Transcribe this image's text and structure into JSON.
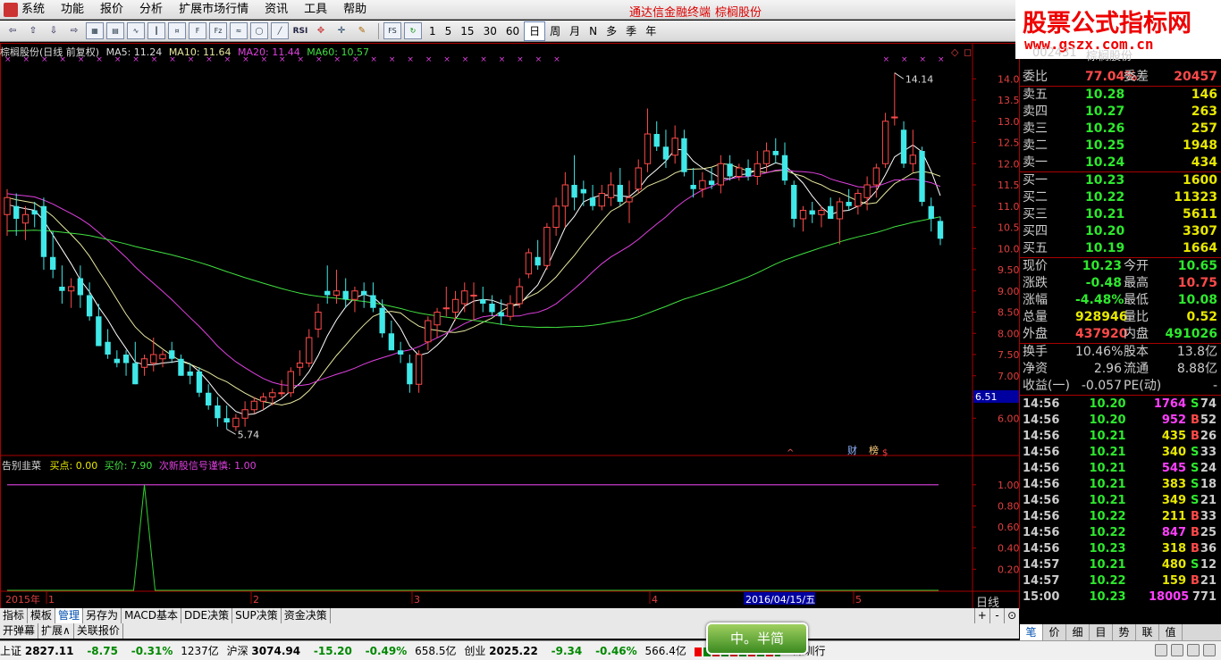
{
  "menu": {
    "items": [
      "系统",
      "功能",
      "报价",
      "分析",
      "扩展市场行情",
      "资讯",
      "工具",
      "帮助"
    ],
    "terminal_title": "通达信金融终端",
    "stock_name": "棕榈股份"
  },
  "watermark": {
    "title": "股票公式指标网",
    "url": "www.gszx.com.cn"
  },
  "toolbar": {
    "periods": [
      "1",
      "5",
      "15",
      "30",
      "60"
    ],
    "tf": [
      "日",
      "周",
      "月",
      "N",
      "多",
      "季",
      "年"
    ],
    "active_tf": "日",
    "icons": [
      "back-icon",
      "up-arrow-icon",
      "down-arrow-icon",
      "forward-icon",
      "grid-icon",
      "table-icon",
      "trend-icon",
      "kline-icon",
      "fund-icon",
      "f10-icon",
      "fiz-icon",
      "flow-icon",
      "circle-icon",
      "chart-line-icon",
      "rsi-icon",
      "pan-icon",
      "move-icon",
      "pen-icon",
      "fs-icon",
      "refresh-icon"
    ],
    "rsi_label": "RSI",
    "fs_label": "FS"
  },
  "chart_header": {
    "title": "棕榈股份(日线 前复权)",
    "ma5": "MA5: 11.24",
    "ma10": "MA10: 11.64",
    "ma20": "MA20: 11.44",
    "ma60": "MA60: 10.57"
  },
  "indicator_header": {
    "name": "告别韭菜",
    "buy_point": "买点: 0.00",
    "buy_price": "买价: 7.90",
    "signal": "次新股信号谨慎: 1.00"
  },
  "price_axis": [
    "14.00",
    "13.50",
    "13.00",
    "12.50",
    "12.00",
    "11.50",
    "11.00",
    "10.50",
    "10.00",
    "9.50",
    "9.00",
    "8.50",
    "8.00",
    "7.50",
    "7.00",
    "6.50",
    "6.00"
  ],
  "current_price_tag": "6.51",
  "indicator_axis": [
    "1.00",
    "0.80",
    "0.60",
    "0.40",
    "0.20"
  ],
  "annotations": {
    "high": "14.14",
    "low": "5.74",
    "cai": "财",
    "bang": "榜",
    "dollar": "$",
    "arrow": "^"
  },
  "x_labels": {
    "year": "2015年",
    "m1": "1",
    "m2": "2",
    "m3": "3",
    "m4": "4",
    "date": "2016/04/15/五",
    "m5": "5"
  },
  "timeframe_label": "日线",
  "side": {
    "code": "002431",
    "name": "棕榈股份",
    "weibi": {
      "label": "委比",
      "value": "77.04%",
      "label2": "委差",
      "value2": "20457"
    },
    "asks": [
      {
        "label": "卖五",
        "price": "10.28",
        "vol": "146"
      },
      {
        "label": "卖四",
        "price": "10.27",
        "vol": "263"
      },
      {
        "label": "卖三",
        "price": "10.26",
        "vol": "257"
      },
      {
        "label": "卖二",
        "price": "10.25",
        "vol": "1948"
      },
      {
        "label": "卖一",
        "price": "10.24",
        "vol": "434"
      }
    ],
    "bids": [
      {
        "label": "买一",
        "price": "10.23",
        "vol": "1600"
      },
      {
        "label": "买二",
        "price": "10.22",
        "vol": "11323"
      },
      {
        "label": "买三",
        "price": "10.21",
        "vol": "5611"
      },
      {
        "label": "买四",
        "price": "10.20",
        "vol": "3307"
      },
      {
        "label": "买五",
        "price": "10.19",
        "vol": "1664"
      }
    ],
    "quote": [
      {
        "l1": "现价",
        "v1": "10.23",
        "c1": "green",
        "l2": "今开",
        "v2": "10.65",
        "c2": "green"
      },
      {
        "l1": "涨跌",
        "v1": "-0.48",
        "c1": "green",
        "l2": "最高",
        "v2": "10.75",
        "c2": "red"
      },
      {
        "l1": "涨幅",
        "v1": "-4.48%",
        "c1": "green",
        "l2": "最低",
        "v2": "10.08",
        "c2": "green"
      },
      {
        "l1": "总量",
        "v1": "928946",
        "c1": "yellow",
        "l2": "量比",
        "v2": "0.52",
        "c2": "yellow"
      },
      {
        "l1": "外盘",
        "v1": "437920",
        "c1": "red",
        "l2": "内盘",
        "v2": "491026",
        "c2": "green"
      }
    ],
    "fund": [
      {
        "l1": "换手",
        "v1": "10.46%",
        "l2": "股本",
        "v2": "13.8亿"
      },
      {
        "l1": "净资",
        "v1": "2.96",
        "l2": "流通",
        "v2": "8.88亿"
      },
      {
        "l1": "收益(一)",
        "v1": "-0.057",
        "l2": "PE(动)",
        "v2": "-"
      }
    ],
    "ticks": [
      {
        "t": "14:56",
        "p": "10.20",
        "pc": "green",
        "v": "1764",
        "vc": "mag",
        "bs": "S",
        "bc": "green",
        "n": "74"
      },
      {
        "t": "14:56",
        "p": "10.20",
        "pc": "green",
        "v": "952",
        "vc": "mag",
        "bs": "B",
        "bc": "red",
        "n": "52"
      },
      {
        "t": "14:56",
        "p": "10.21",
        "pc": "green",
        "v": "435",
        "vc": "yellow",
        "bs": "B",
        "bc": "red",
        "n": "26"
      },
      {
        "t": "14:56",
        "p": "10.21",
        "pc": "green",
        "v": "340",
        "vc": "yellow",
        "bs": "S",
        "bc": "green",
        "n": "33"
      },
      {
        "t": "14:56",
        "p": "10.21",
        "pc": "green",
        "v": "545",
        "vc": "mag",
        "bs": "S",
        "bc": "green",
        "n": "24"
      },
      {
        "t": "14:56",
        "p": "10.21",
        "pc": "green",
        "v": "383",
        "vc": "yellow",
        "bs": "S",
        "bc": "green",
        "n": "18"
      },
      {
        "t": "14:56",
        "p": "10.21",
        "pc": "green",
        "v": "349",
        "vc": "yellow",
        "bs": "S",
        "bc": "green",
        "n": "21"
      },
      {
        "t": "14:56",
        "p": "10.22",
        "pc": "green",
        "v": "211",
        "vc": "yellow",
        "bs": "B",
        "bc": "red",
        "n": "33"
      },
      {
        "t": "14:56",
        "p": "10.22",
        "pc": "green",
        "v": "847",
        "vc": "mag",
        "bs": "B",
        "bc": "red",
        "n": "25"
      },
      {
        "t": "14:56",
        "p": "10.23",
        "pc": "green",
        "v": "318",
        "vc": "yellow",
        "bs": "B",
        "bc": "red",
        "n": "36"
      },
      {
        "t": "14:57",
        "p": "10.21",
        "pc": "green",
        "v": "480",
        "vc": "yellow",
        "bs": "S",
        "bc": "green",
        "n": "12"
      },
      {
        "t": "14:57",
        "p": "10.22",
        "pc": "green",
        "v": "159",
        "vc": "yellow",
        "bs": "B",
        "bc": "red",
        "n": "21"
      },
      {
        "t": "15:00",
        "p": "10.23",
        "pc": "green",
        "v": "18005",
        "vc": "mag",
        "bs": "",
        "bc": "green",
        "n": "771"
      }
    ],
    "tabs": [
      "笔",
      "价",
      "细",
      "目",
      "势",
      "联",
      "值"
    ]
  },
  "bottom_tabs": [
    "指标",
    "模板",
    "管理",
    "另存为",
    "MACD基本",
    "DDE决策",
    "SUP决策",
    "资金决策"
  ],
  "bottom_active": "管理",
  "bottom_row2": [
    "开弹幕",
    "扩展∧",
    "关联报价"
  ],
  "small_btns": [
    "+",
    "-",
    "⊙"
  ],
  "status": {
    "sh": {
      "name": "上证",
      "value": "2827.11",
      "change": "-8.75",
      "pct": "-0.31%",
      "amount": "1237亿"
    },
    "sz": {
      "name": "沪深",
      "value": "3074.94",
      "change": "-15.20",
      "pct": "-0.49%",
      "amount": "658.5亿"
    },
    "cy": {
      "name": "创业",
      "value": "2025.22",
      "change": "-9.34",
      "pct": "-0.46%",
      "amount": "566.4亿"
    },
    "extra": "深圳行",
    "badge": "中。半简"
  },
  "colors": {
    "up": "#ff4a4a",
    "down": "#40e8e8",
    "ma5": "#ffffff",
    "ma10": "#e8e8a0",
    "ma20": "#e040e0",
    "ma60": "#40e040",
    "signal": "#e040e0"
  },
  "chart_data": {
    "type": "candlestick",
    "title": "棕榈股份(日线 前复权)",
    "ylim": [
      5.5,
      14.3
    ],
    "candles": [
      [
        10.8,
        11.4,
        10.3,
        11.2
      ],
      [
        11.0,
        11.3,
        10.3,
        10.7
      ],
      [
        10.6,
        11.0,
        10.2,
        10.8
      ],
      [
        10.9,
        11.1,
        10.5,
        10.8
      ],
      [
        11.0,
        11.2,
        9.5,
        9.8
      ],
      [
        9.8,
        10.4,
        9.3,
        9.5
      ],
      [
        9.1,
        9.6,
        8.7,
        9.0
      ],
      [
        9.0,
        9.3,
        8.6,
        9.1
      ],
      [
        9.3,
        9.6,
        8.6,
        8.9
      ],
      [
        8.9,
        9.2,
        8.3,
        8.4
      ],
      [
        8.4,
        8.7,
        7.8,
        7.7
      ],
      [
        7.8,
        8.1,
        7.4,
        7.5
      ],
      [
        7.4,
        7.6,
        7.2,
        7.3
      ],
      [
        7.5,
        7.6,
        7.0,
        7.3
      ],
      [
        7.3,
        7.8,
        6.8,
        6.8
      ],
      [
        7.2,
        7.5,
        7.0,
        7.4
      ],
      [
        7.3,
        7.9,
        7.1,
        7.5
      ],
      [
        7.4,
        7.6,
        7.2,
        7.5
      ],
      [
        7.6,
        7.8,
        7.3,
        7.4
      ],
      [
        7.4,
        7.5,
        7.0,
        7.0
      ],
      [
        7.1,
        7.3,
        6.8,
        7.0
      ],
      [
        7.1,
        7.2,
        6.5,
        6.6
      ],
      [
        6.6,
        6.8,
        6.2,
        6.3
      ],
      [
        6.3,
        6.5,
        5.8,
        6.0
      ],
      [
        6.0,
        6.3,
        5.74,
        5.9
      ],
      [
        5.8,
        6.1,
        5.7,
        6.0
      ],
      [
        6.0,
        6.4,
        5.8,
        6.2
      ],
      [
        6.2,
        6.5,
        6.1,
        6.4
      ],
      [
        6.4,
        6.6,
        6.2,
        6.5
      ],
      [
        6.5,
        6.7,
        6.3,
        6.6
      ],
      [
        6.6,
        6.9,
        6.5,
        6.6
      ],
      [
        6.6,
        7.2,
        6.5,
        7.1
      ],
      [
        7.2,
        7.6,
        7.0,
        7.3
      ],
      [
        7.3,
        8.1,
        7.2,
        7.9
      ],
      [
        8.1,
        8.7,
        7.9,
        8.5
      ],
      [
        9.0,
        9.6,
        8.7,
        8.9
      ],
      [
        8.9,
        9.5,
        8.7,
        9.0
      ],
      [
        9.0,
        9.3,
        8.6,
        8.8
      ],
      [
        8.8,
        9.1,
        8.5,
        9.0
      ],
      [
        9.0,
        9.2,
        8.6,
        8.9
      ],
      [
        8.9,
        9.2,
        8.5,
        8.6
      ],
      [
        8.6,
        8.8,
        7.9,
        8.0
      ],
      [
        8.0,
        8.3,
        7.7,
        7.6
      ],
      [
        7.6,
        7.8,
        7.3,
        7.5
      ],
      [
        7.3,
        7.5,
        6.6,
        6.8
      ],
      [
        6.8,
        7.6,
        6.6,
        7.5
      ],
      [
        7.8,
        8.4,
        7.6,
        8.3
      ],
      [
        8.2,
        8.6,
        7.9,
        8.5
      ],
      [
        8.6,
        9.1,
        8.4,
        8.6
      ],
      [
        8.5,
        9.0,
        8.3,
        8.8
      ],
      [
        8.7,
        9.2,
        8.5,
        9.0
      ],
      [
        8.9,
        9.2,
        8.3,
        8.9
      ],
      [
        8.8,
        9.1,
        8.5,
        8.7
      ],
      [
        8.7,
        8.9,
        8.4,
        8.5
      ],
      [
        8.5,
        8.8,
        8.2,
        8.4
      ],
      [
        8.4,
        8.9,
        8.3,
        8.7
      ],
      [
        8.7,
        9.3,
        8.6,
        9.1
      ],
      [
        9.4,
        10.0,
        9.3,
        9.9
      ],
      [
        9.8,
        10.2,
        9.5,
        9.6
      ],
      [
        9.6,
        10.6,
        9.5,
        10.5
      ],
      [
        10.5,
        11.2,
        10.3,
        11.0
      ],
      [
        11.0,
        11.8,
        10.5,
        11.5
      ],
      [
        11.5,
        12.2,
        10.9,
        11.2
      ],
      [
        11.4,
        11.6,
        11.0,
        11.3
      ],
      [
        11.2,
        11.5,
        10.9,
        11.0
      ],
      [
        11.0,
        11.5,
        10.9,
        11.3
      ],
      [
        11.2,
        11.8,
        11.0,
        11.5
      ],
      [
        11.5,
        11.9,
        11.0,
        11.1
      ],
      [
        11.1,
        11.6,
        10.6,
        11.2
      ],
      [
        11.4,
        12.1,
        11.3,
        11.9
      ],
      [
        12.0,
        13.3,
        11.8,
        12.7
      ],
      [
        12.7,
        13.0,
        12.3,
        12.4
      ],
      [
        12.4,
        12.8,
        11.9,
        12.1
      ],
      [
        12.2,
        12.9,
        12.0,
        12.6
      ],
      [
        12.6,
        12.8,
        11.7,
        11.8
      ],
      [
        11.5,
        11.9,
        11.2,
        11.4
      ],
      [
        11.4,
        11.8,
        11.2,
        11.6
      ],
      [
        11.6,
        11.9,
        11.4,
        11.5
      ],
      [
        11.5,
        12.2,
        11.3,
        12.0
      ],
      [
        12.0,
        12.2,
        11.6,
        11.7
      ],
      [
        11.7,
        12.0,
        11.6,
        11.9
      ],
      [
        11.9,
        12.1,
        11.6,
        11.7
      ],
      [
        11.7,
        12.3,
        11.5,
        12.0
      ],
      [
        12.0,
        12.5,
        11.8,
        12.3
      ],
      [
        12.3,
        12.6,
        12.0,
        12.2
      ],
      [
        12.2,
        12.5,
        11.5,
        11.6
      ],
      [
        11.5,
        11.6,
        10.5,
        10.7
      ],
      [
        10.7,
        11.0,
        10.4,
        10.9
      ],
      [
        10.9,
        11.1,
        10.6,
        10.8
      ],
      [
        10.8,
        11.0,
        10.5,
        10.9
      ],
      [
        11.0,
        11.2,
        10.7,
        10.7
      ],
      [
        10.7,
        11.2,
        10.1,
        11.1
      ],
      [
        11.1,
        11.4,
        10.9,
        11.0
      ],
      [
        11.0,
        11.4,
        10.8,
        11.3
      ],
      [
        11.2,
        11.7,
        10.9,
        11.5
      ],
      [
        11.5,
        12.0,
        11.2,
        11.9
      ],
      [
        12.0,
        13.2,
        11.9,
        13.0
      ],
      [
        13.1,
        14.14,
        12.9,
        13.1
      ],
      [
        12.8,
        13.0,
        11.9,
        12.0
      ],
      [
        12.0,
        12.8,
        11.8,
        12.2
      ],
      [
        12.3,
        12.4,
        11.0,
        11.1
      ],
      [
        11.0,
        11.2,
        10.4,
        10.7
      ],
      [
        10.65,
        10.75,
        10.08,
        10.23
      ]
    ],
    "ma": {
      "ma5": "MA5: 11.24",
      "ma10": "MA10: 11.64",
      "ma20": "MA20: 11.44",
      "ma60": "MA60: 10.57"
    },
    "indicator": {
      "type": "line",
      "name": "告别韭菜",
      "ylim": [
        0,
        1.1
      ],
      "spike_index": 15,
      "signal_level": 1.0
    }
  }
}
